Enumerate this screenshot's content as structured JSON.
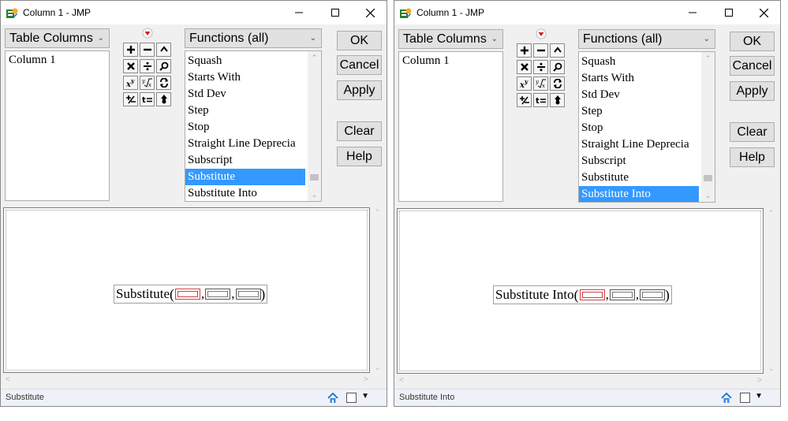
{
  "windows": [
    {
      "title": "Column 1 - JMP",
      "table_columns_label": "Table Columns",
      "columns": [
        "Column 1"
      ],
      "functions_label": "Functions (all)",
      "functions": [
        "Squash",
        "Starts With",
        "Std Dev",
        "Step",
        "Stop",
        "Straight Line Deprecia",
        "Subscript",
        "Substitute",
        "Substitute Into"
      ],
      "selected_function": "Substitute",
      "buttons": {
        "ok": "OK",
        "cancel": "Cancel",
        "apply": "Apply",
        "clear": "Clear",
        "help": "Help"
      },
      "formula_name": "Substitute",
      "status": "Substitute"
    },
    {
      "title": "Column 1 - JMP",
      "table_columns_label": "Table Columns",
      "columns": [
        "Column 1"
      ],
      "functions_label": "Functions (all)",
      "functions": [
        "Squash",
        "Starts With",
        "Std Dev",
        "Step",
        "Stop",
        "Straight Line Deprecia",
        "Subscript",
        "Substitute",
        "Substitute Into"
      ],
      "selected_function": "Substitute Into",
      "buttons": {
        "ok": "OK",
        "cancel": "Cancel",
        "apply": "Apply",
        "clear": "Clear",
        "help": "Help"
      },
      "formula_name": "Substitute Into",
      "status": "Substitute Into"
    }
  ],
  "icons": {
    "app": "jmp-app-icon",
    "minimize": "minimize-icon",
    "maximize": "maximize-icon",
    "close": "close-icon",
    "keypad": [
      "plus-icon",
      "minus-icon",
      "caret-up-icon",
      "multiply-icon",
      "divide-icon",
      "search-icon",
      "power-icon",
      "root-icon",
      "swap-icon",
      "plus-minus-icon",
      "assign-icon",
      "local-icon"
    ],
    "home": "home-icon"
  },
  "colors": {
    "selection": "#3399ff",
    "active_slot": "#d04040"
  }
}
